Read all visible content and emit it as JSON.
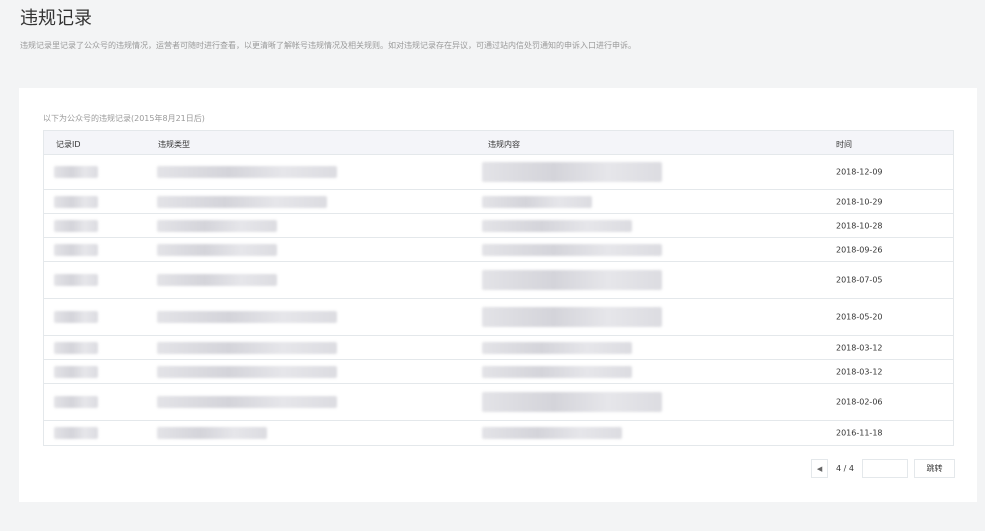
{
  "page": {
    "title": "违规记录",
    "description": "违规记录里记录了公众号的违规情况，运营者可随时进行查看，以更清晰了解帐号违规情况及相关规则。如对违规记录存在异议，可通过站内信处罚通知的申诉入口进行申诉。"
  },
  "table": {
    "subtitle": "以下为公众号的违规记录(2015年8月21日后)",
    "headers": {
      "id": "记录ID",
      "type": "违规类型",
      "content": "违规内容",
      "time": "时间"
    },
    "rows": [
      {
        "time": "2018-12-09"
      },
      {
        "time": "2018-10-29"
      },
      {
        "time": "2018-10-28"
      },
      {
        "time": "2018-09-26"
      },
      {
        "time": "2018-07-05"
      },
      {
        "time": "2018-05-20"
      },
      {
        "time": "2018-03-12"
      },
      {
        "time": "2018-03-12"
      },
      {
        "time": "2018-02-06"
      },
      {
        "time": "2016-11-18"
      }
    ]
  },
  "pagination": {
    "prev_icon": "chevron-left-icon",
    "page_indicator": "4 / 4",
    "jump_input": "",
    "jump_label": "跳转"
  }
}
